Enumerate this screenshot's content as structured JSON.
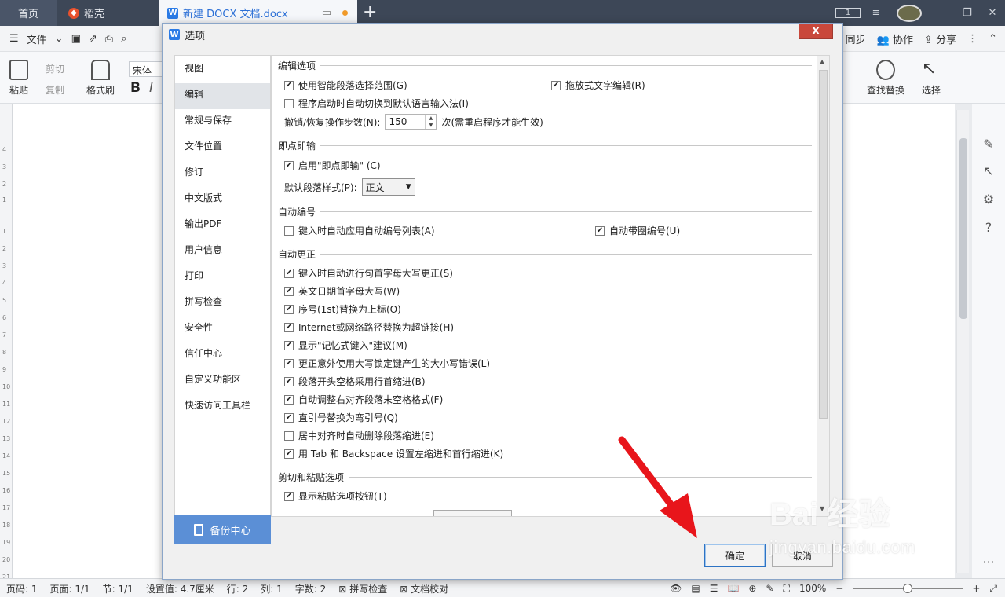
{
  "tabs": {
    "home": "首页",
    "daoke": "稻壳",
    "doc": "新建 DOCX 文档.docx",
    "page_badge": "1"
  },
  "menu": {
    "file": "文件",
    "sync": "同步",
    "collab": "协作",
    "share": "分享"
  },
  "toolbar": {
    "paste": "粘贴",
    "cut": "剪切",
    "copy": "复制",
    "format_painter": "格式刷",
    "font": "宋体",
    "bold": "B",
    "find_replace": "查找替换",
    "select": "选择"
  },
  "ruler": [
    "4",
    "3",
    "2",
    "1",
    "1",
    "2",
    "3",
    "4",
    "5",
    "6",
    "7",
    "8",
    "9",
    "10",
    "11",
    "12",
    "13",
    "14",
    "15",
    "16",
    "17",
    "18",
    "19",
    "20",
    "21"
  ],
  "dialog": {
    "title": "选项",
    "close": "x",
    "nav": [
      {
        "label": "视图",
        "active": false
      },
      {
        "label": "编辑",
        "active": true
      },
      {
        "label": "常规与保存",
        "active": false
      },
      {
        "label": "文件位置",
        "active": false
      },
      {
        "label": "修订",
        "active": false
      },
      {
        "label": "中文版式",
        "active": false
      },
      {
        "label": "输出PDF",
        "active": false
      },
      {
        "label": "用户信息",
        "active": false
      },
      {
        "label": "打印",
        "active": false
      },
      {
        "label": "拼写检查",
        "active": false
      },
      {
        "label": "安全性",
        "active": false
      },
      {
        "label": "信任中心",
        "active": false
      },
      {
        "label": "自定义功能区",
        "active": false
      },
      {
        "label": "快速访问工具栏",
        "active": false
      }
    ],
    "backup": "备份中心",
    "sections": {
      "edit": "编辑选项",
      "click_type": "即点即输",
      "auto_number": "自动编号",
      "auto_correct": "自动更正",
      "cut_paste": "剪切和粘贴选项"
    },
    "edit_options": {
      "smart_paragraph": {
        "label": "使用智能段落选择范围(G)",
        "checked": true
      },
      "drag_drop": {
        "label": "拖放式文字编辑(R)",
        "checked": true
      },
      "auto_ime": {
        "label": "程序启动时自动切换到默认语言输入法(I)",
        "checked": false
      },
      "undo_label": "撤销/恢复操作步数(N):",
      "undo_value": "150",
      "undo_suffix": "次(需重启程序才能生效)"
    },
    "click_type": {
      "enable": {
        "label": "启用\"即点即输\" (C)",
        "checked": true
      },
      "default_style_label": "默认段落样式(P):",
      "default_style_value": "正文"
    },
    "auto_number": {
      "apply_list": {
        "label": "键入时自动应用自动编号列表(A)",
        "checked": false
      },
      "circled": {
        "label": "自动带圈编号(U)",
        "checked": true
      }
    },
    "auto_correct": [
      {
        "label": "键入时自动进行句首字母大写更正(S)",
        "checked": true
      },
      {
        "label": "英文日期首字母大写(W)",
        "checked": true
      },
      {
        "label": "序号(1st)替换为上标(O)",
        "checked": true
      },
      {
        "label": "Internet或网络路径替换为超链接(H)",
        "checked": true
      },
      {
        "label": "显示\"记忆式键入\"建议(M)",
        "checked": true
      },
      {
        "label": "更正意外使用大写锁定键产生的大小写错误(L)",
        "checked": true
      },
      {
        "label": "段落开头空格采用行首缩进(B)",
        "checked": true
      },
      {
        "label": "自动调整右对齐段落末空格格式(F)",
        "checked": true
      },
      {
        "label": "直引号替换为弯引号(Q)",
        "checked": true
      },
      {
        "label": "居中对齐时自动删除段落缩进(E)",
        "checked": false
      },
      {
        "label": "用 Tab 和 Backspace 设置左缩进和首行缩进(K)",
        "checked": true
      }
    ],
    "cut_paste": {
      "show_button": {
        "label": "显示粘贴选项按钮(T)",
        "checked": true
      }
    },
    "ok": "确定",
    "cancel": "取消"
  },
  "status": {
    "page_code": "页码: 1",
    "pages": "页面: 1/1",
    "section": "节: 1/1",
    "setting": "设置值: 4.7厘米",
    "row": "行: 2",
    "col": "列: 1",
    "words": "字数: 2",
    "spell": "拼写检查",
    "doc_check": "文档校对",
    "zoom": "100%"
  },
  "watermark": {
    "brand": "Bai  经验",
    "url": "jingyan.baidu.com"
  },
  "colors": {
    "tabbar": "#3d4757",
    "accent": "#2b6fd6",
    "close": "#c9483b",
    "backup": "#5b8fd6",
    "arrow": "#e8151b"
  }
}
